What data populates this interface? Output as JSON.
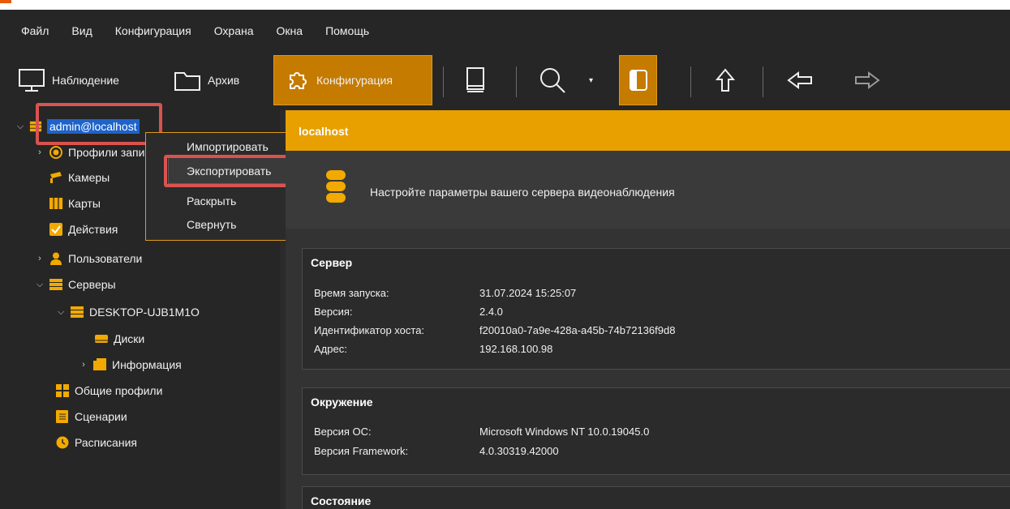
{
  "menu": [
    "Файл",
    "Вид",
    "Конфигурация",
    "Охрана",
    "Окна",
    "Помощь"
  ],
  "toolbar": {
    "monitoring_label": "Наблюдение",
    "archive_label": "Архив",
    "config_label": "Конфигурация",
    "accent": "#c47b00"
  },
  "tree": {
    "root": "admin@localhost",
    "items": [
      {
        "label": "Профили записи"
      },
      {
        "label": "Камеры"
      },
      {
        "label": "Карты"
      },
      {
        "label": "Действия"
      },
      {
        "label": "Пользователи"
      },
      {
        "label": "Серверы"
      },
      {
        "label": "DESKTOP-UJB1M1O"
      },
      {
        "label": "Диски"
      },
      {
        "label": "Информация"
      },
      {
        "label": "Общие профили"
      },
      {
        "label": "Сценарии"
      },
      {
        "label": "Расписания"
      }
    ]
  },
  "context_menu": {
    "items": [
      "Импортировать",
      "Экспортировать",
      "Раскрыть",
      "Свернуть"
    ]
  },
  "content": {
    "header": "localhost",
    "description": "Настройте параметры вашего сервера видеонаблюдения",
    "server": {
      "title": "Сервер",
      "rows": [
        {
          "k": "Время запуска:",
          "v": "31.07.2024 15:25:07"
        },
        {
          "k": "Версия:",
          "v": "2.4.0"
        },
        {
          "k": "Идентификатор хоста:",
          "v": "f20010a0-7a9e-428a-a45b-74b72136f9d8"
        },
        {
          "k": "Адрес:",
          "v": "192.168.100.98"
        }
      ]
    },
    "environment": {
      "title": "Окружение",
      "rows": [
        {
          "k": "Версия ОС:",
          "v": "Microsoft Windows NT 10.0.19045.0"
        },
        {
          "k": "Версия Framework:",
          "v": "4.0.30319.42000"
        }
      ]
    },
    "state": {
      "title": "Состояние"
    }
  }
}
